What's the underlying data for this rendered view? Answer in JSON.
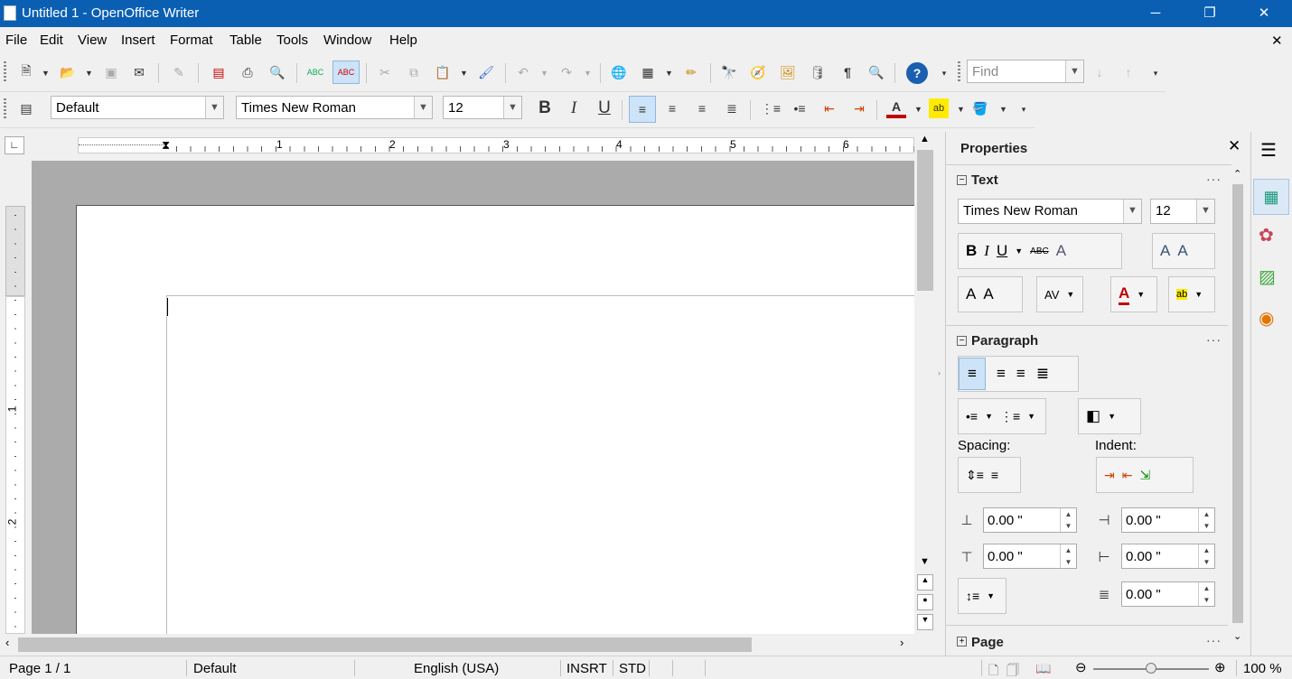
{
  "window": {
    "title": "Untitled 1 - OpenOffice Writer",
    "minimize": "─",
    "maximize": "❐",
    "close": "✕"
  },
  "menu": [
    "File",
    "Edit",
    "View",
    "Insert",
    "Format",
    "Table",
    "Tools",
    "Window",
    "Help"
  ],
  "menu_close": "✕",
  "standard_toolbar": {
    "find_placeholder": "Find"
  },
  "formatting_toolbar": {
    "style": "Default",
    "font": "Times New Roman",
    "size": "12",
    "bold": "B",
    "italic": "I",
    "underline": "U"
  },
  "ruler": {
    "h_labels": [
      "1",
      "2",
      "3",
      "4",
      "5",
      "6"
    ],
    "v_labels": [
      "1",
      "2"
    ]
  },
  "sidebar": {
    "title": "Properties",
    "text_section": {
      "title": "Text",
      "font": "Times New Roman",
      "size": "12"
    },
    "paragraph_section": {
      "title": "Paragraph",
      "spacing_label": "Spacing:",
      "indent_label": "Indent:",
      "above": "0.00 \"",
      "below": "0.00 \"",
      "before": "0.00 \"",
      "after": "0.00 \"",
      "first_line": "0.00 \""
    },
    "page_section": {
      "title": "Page"
    }
  },
  "status": {
    "page": "Page 1 / 1",
    "style": "Default",
    "language": "English (USA)",
    "insert_mode": "INSRT",
    "selection_mode": "STD",
    "zoom": "100 %"
  },
  "colors": {
    "titlebar": "#0a5fb3",
    "accent": "#1a73c9",
    "font_color": "#c00000",
    "highlight": "#ffeb00"
  }
}
